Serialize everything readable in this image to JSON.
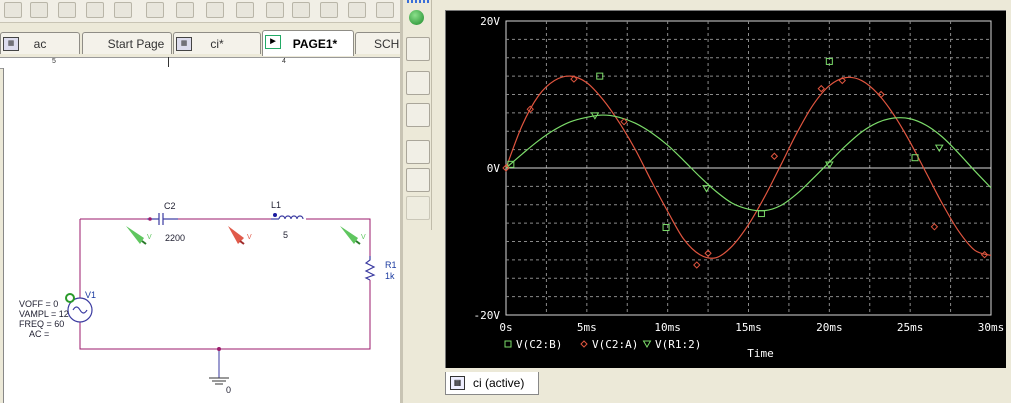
{
  "tabs": [
    {
      "label": "ac",
      "icon": "schematic-icon"
    },
    {
      "label": "Start Page"
    },
    {
      "label": "ci*",
      "icon": "schematic-icon"
    },
    {
      "label": "PAGE1*",
      "icon": "page-icon"
    },
    {
      "label": "SCHE"
    }
  ],
  "ruler": {
    "left": "5",
    "right": "4"
  },
  "schematic": {
    "c2": {
      "ref": "C2",
      "value": "2200"
    },
    "l1": {
      "ref": "L1",
      "value": "5"
    },
    "r1": {
      "ref": "R1",
      "value": "1k"
    },
    "v1": {
      "ref": "V1",
      "voff": "VOFF = 0",
      "vampl": "VAMPL = 12",
      "freq": "FREQ = 60",
      "ac": "AC ="
    },
    "ground": "0",
    "probe_label": "V"
  },
  "probe_tab": {
    "label": "ci (active)"
  },
  "colors": {
    "red": "#e0553f",
    "green": "#7cdc6a",
    "teal": "#1cc9a0",
    "grid": "#8a8a8a"
  },
  "chart_data": {
    "type": "line",
    "xlabel": "Time",
    "ylabel": "",
    "xlim": [
      0,
      30
    ],
    "ylim": [
      -20,
      20
    ],
    "x_ticks": [
      "0s",
      "5ms",
      "10ms",
      "15ms",
      "20ms",
      "25ms",
      "30ms"
    ],
    "y_ticks": [
      "20V",
      "0V",
      "-20V"
    ],
    "grid": true,
    "legend": "bottom-left",
    "series": [
      {
        "name": "V(C2:B)",
        "marker": "square",
        "color": "#7cdc6a",
        "x": [
          0.3,
          5.8,
          9.9,
          15.8,
          20.0,
          25.3
        ],
        "y": [
          0.5,
          12.5,
          -8.1,
          -6.2,
          14.5,
          1.4
        ]
      },
      {
        "name": "V(C2:A)",
        "marker": "diamond",
        "color": "#e0553f",
        "x": [
          0,
          1.5,
          4.2,
          7.3,
          11.8,
          12.5,
          16.6,
          19.5,
          20.8,
          23.2,
          26.5,
          29.6
        ],
        "y": [
          0,
          8.0,
          12.1,
          6.3,
          -13.2,
          -11.6,
          1.6,
          10.8,
          11.9,
          10.0,
          -8.0,
          -11.8
        ],
        "samples": [
          [
            0,
            0
          ],
          [
            1,
            5.8
          ],
          [
            2,
            9.8
          ],
          [
            3,
            11.9
          ],
          [
            4,
            12.5
          ],
          [
            5,
            11.6
          ],
          [
            6,
            9.3
          ],
          [
            7,
            6.2
          ],
          [
            8,
            2.5
          ],
          [
            9,
            -1.8
          ],
          [
            10,
            -5.9
          ],
          [
            11,
            -9.7
          ],
          [
            12,
            -11.8
          ],
          [
            13,
            -12.2
          ],
          [
            14,
            -10.6
          ],
          [
            15,
            -7.7
          ],
          [
            16,
            -3.9
          ],
          [
            17,
            0.4
          ],
          [
            18,
            4.8
          ],
          [
            19,
            8.6
          ],
          [
            20,
            11.2
          ],
          [
            21,
            12.3
          ],
          [
            22,
            11.9
          ],
          [
            23,
            10.1
          ],
          [
            24,
            7.2
          ],
          [
            25,
            3.5
          ],
          [
            26,
            -0.7
          ],
          [
            27,
            -4.9
          ],
          [
            28,
            -8.6
          ],
          [
            29,
            -11.2
          ],
          [
            30,
            -11.9
          ]
        ]
      },
      {
        "name": "V(R1:2)",
        "marker": "triangle",
        "color": "#7cdc6a",
        "x": [
          5.5,
          12.4,
          20.0,
          26.8
        ],
        "y": [
          7.1,
          -2.8,
          0.4,
          2.7
        ],
        "samples": [
          [
            0,
            0
          ],
          [
            1,
            1.9
          ],
          [
            2,
            3.7
          ],
          [
            3,
            5.2
          ],
          [
            4,
            6.3
          ],
          [
            5,
            6.9
          ],
          [
            6,
            7.2
          ],
          [
            7,
            6.9
          ],
          [
            8,
            6.1
          ],
          [
            9,
            4.8
          ],
          [
            10,
            3.1
          ],
          [
            11,
            1.0
          ],
          [
            12,
            -1.2
          ],
          [
            13,
            -3.2
          ],
          [
            14,
            -4.8
          ],
          [
            15,
            -5.6
          ],
          [
            16,
            -5.8
          ],
          [
            17,
            -5.1
          ],
          [
            18,
            -3.5
          ],
          [
            19,
            -1.4
          ],
          [
            20,
            0.8
          ],
          [
            21,
            3.0
          ],
          [
            22,
            4.9
          ],
          [
            23,
            6.2
          ],
          [
            24,
            6.8
          ],
          [
            25,
            6.7
          ],
          [
            26,
            5.8
          ],
          [
            27,
            4.2
          ],
          [
            28,
            2.0
          ],
          [
            29,
            -0.4
          ],
          [
            30,
            -2.7
          ]
        ]
      }
    ]
  }
}
